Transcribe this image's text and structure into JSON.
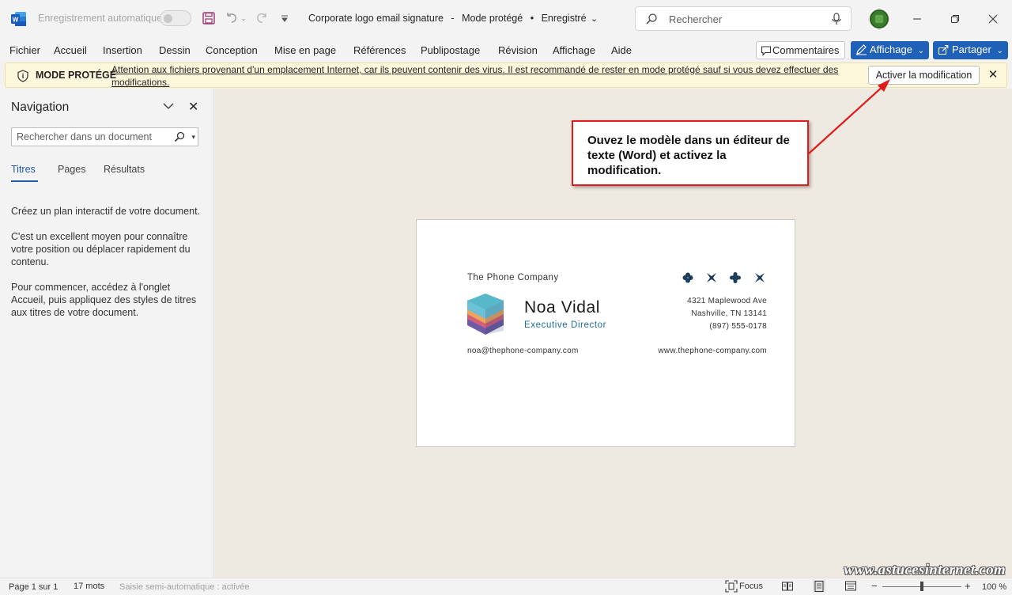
{
  "titlebar": {
    "autosave_label": "Enregistrement automatique",
    "doc_name": "Corporate logo email signature",
    "mode": "Mode protégé",
    "saved": "Enregistré",
    "separator": "-",
    "dot": "•",
    "search_placeholder": "Rechercher"
  },
  "menu": {
    "items": [
      "Fichier",
      "Accueil",
      "Insertion",
      "Dessin",
      "Conception",
      "Mise en page",
      "Références",
      "Publipostage",
      "Révision",
      "Affichage",
      "Aide"
    ],
    "comments_label": "Commentaires",
    "view_label": "Affichage",
    "share_label": "Partager"
  },
  "protected_bar": {
    "label": "MODE PROTÉGÉ",
    "message": "Attention aux fichiers provenant d'un emplacement Internet, car ils peuvent contenir des virus. Il est recommandé de rester en mode protégé sauf si vous devez effectuer des modifications.",
    "enable_button": "Activer la modification"
  },
  "navigation": {
    "title": "Navigation",
    "search_placeholder": "Rechercher dans un document",
    "tabs": [
      "Titres",
      "Pages",
      "Résultats"
    ],
    "active_tab": "Titres",
    "paragraphs": [
      "Créez un plan interactif de votre document.",
      "C'est un excellent moyen pour connaître votre position ou déplacer rapidement du contenu.",
      "Pour commencer, accédez à l'onglet Accueil, puis appliquez des styles de titres aux titres de votre document."
    ]
  },
  "signature": {
    "company": "The Phone Company",
    "name": "Noa Vidal",
    "role": "Executive Director",
    "address_line1": "4321 Maplewood Ave",
    "address_line2": "Nashville, TN 13141",
    "phone": "(897) 555-0178",
    "email": "noa@thephone-company.com",
    "website": "www.thephone-company.com",
    "social_icons": [
      "clover-icon",
      "bowtie-icon",
      "flower-icon",
      "bowtie-icon"
    ],
    "accent_color": "#1e6f9c"
  },
  "callout": {
    "text": "Ouvez le modèle dans un éditeur de texte (Word) et activez la modification."
  },
  "statusbar": {
    "page": "Page 1 sur 1",
    "words": "17 mots",
    "autocomplete": "Saisie semi-automatique : activée",
    "focus": "Focus",
    "zoom_minus": "−",
    "zoom_plus": "+",
    "zoom": "100 %"
  },
  "watermark": "www.astucesinternet.com"
}
